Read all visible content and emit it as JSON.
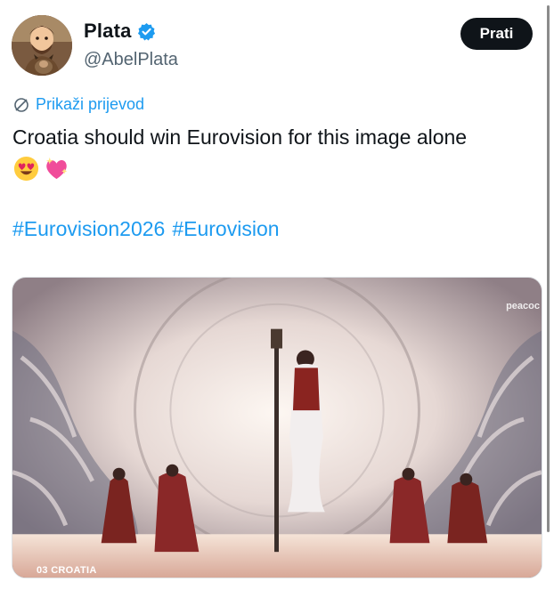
{
  "author": {
    "display_name": "Plata",
    "handle": "@AbelPlata",
    "avatar_icon": "avatar-person-with-dog"
  },
  "follow_label": "Prati",
  "translate_label": "Prikaži prijevod",
  "tweet": {
    "text": "Croatia should win Eurovision for this image alone",
    "emojis": [
      "smiling-face-with-heart-eyes",
      "sparkling-heart"
    ],
    "hashtags": [
      "#Eurovision2026",
      "#Eurovision"
    ]
  },
  "media": {
    "watermark": "peacoc",
    "caption": "03 CROATIA"
  },
  "colors": {
    "accent": "#1d9bf0",
    "text": "#0f1419",
    "secondary": "#536471",
    "button_bg": "#0f1419"
  }
}
